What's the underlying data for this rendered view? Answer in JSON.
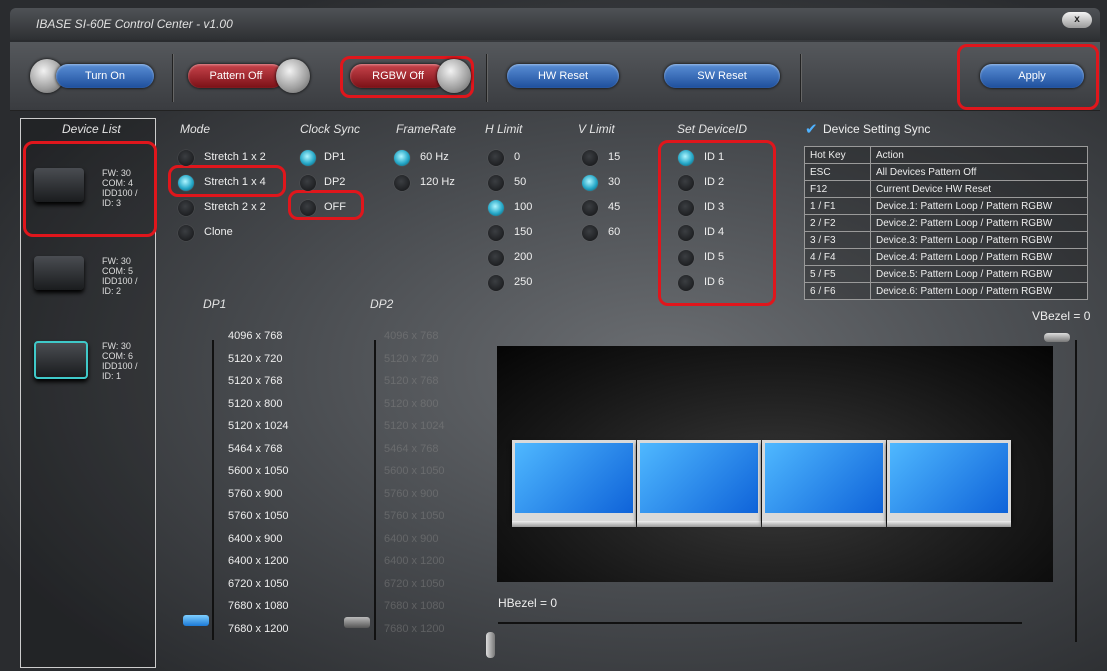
{
  "window": {
    "title": "IBASE SI-60E Control Center - v1.00",
    "close_label": "x"
  },
  "toolbar": {
    "turn_on": "Turn On",
    "pattern_off": "Pattern Off",
    "rgbw_off": "RGBW Off",
    "hw_reset": "HW Reset",
    "sw_reset": "SW Reset",
    "apply": "Apply"
  },
  "device_list": {
    "header": "Device List",
    "devices": [
      {
        "fw": "FW: 30",
        "com": "COM: 4",
        "idd": "IDD100 /",
        "id": "ID: 3"
      },
      {
        "fw": "FW: 30",
        "com": "COM: 5",
        "idd": "IDD100 /",
        "id": "ID: 2"
      },
      {
        "fw": "FW: 30",
        "com": "COM: 6",
        "idd": "IDD100 /",
        "id": "ID: 1"
      }
    ]
  },
  "headers": {
    "mode": "Mode",
    "clock_sync": "Clock Sync",
    "frame_rate": "FrameRate",
    "h_limit": "H Limit",
    "v_limit": "V Limit",
    "set_device_id": "Set DeviceID",
    "device_setting_sync": "Device Setting Sync"
  },
  "mode": [
    "Stretch 1 x 2",
    "Stretch 1 x 4",
    "Stretch 2 x 2",
    "Clone"
  ],
  "clock_sync": [
    "DP1",
    "DP2",
    "OFF"
  ],
  "frame_rate": [
    "60 Hz",
    "120 Hz"
  ],
  "h_limit": [
    "0",
    "50",
    "100",
    "150",
    "200",
    "250"
  ],
  "v_limit": [
    "15",
    "30",
    "45",
    "60"
  ],
  "device_ids": [
    "ID 1",
    "ID 2",
    "ID 3",
    "ID 4",
    "ID 5",
    "ID 6"
  ],
  "selected": {
    "mode": 1,
    "clock_sync": 0,
    "frame_rate": 0,
    "h_limit": 2,
    "v_limit": 1,
    "device_id": 0
  },
  "hotkeys": {
    "col_key": "Hot Key",
    "col_action": "Action",
    "rows": [
      {
        "key": "ESC",
        "action": "All Devices Pattern Off"
      },
      {
        "key": "F12",
        "action": "Current Device HW Reset"
      },
      {
        "key": "1 / F1",
        "action": "Device.1: Pattern Loop / Pattern RGBW"
      },
      {
        "key": "2 / F2",
        "action": "Device.2: Pattern Loop / Pattern RGBW"
      },
      {
        "key": "3 / F3",
        "action": "Device.3: Pattern Loop / Pattern RGBW"
      },
      {
        "key": "4 / F4",
        "action": "Device.4: Pattern Loop / Pattern RGBW"
      },
      {
        "key": "5 / F5",
        "action": "Device.5: Pattern Loop / Pattern RGBW"
      },
      {
        "key": "6 / F6",
        "action": "Device.6: Pattern Loop / Pattern RGBW"
      }
    ]
  },
  "dp1": {
    "label": "DP1",
    "resolutions": [
      "4096 x 768",
      "5120 x 720",
      "5120 x 768",
      "5120 x 800",
      "5120 x 1024",
      "5464 x 768",
      "5600 x 1050",
      "5760 x 900",
      "5760 x 1050",
      "6400 x 900",
      "6400 x 1200",
      "6720 x 1050",
      "7680 x 1080",
      "7680 x 1200"
    ]
  },
  "dp2": {
    "label": "DP2",
    "resolutions": [
      "4096 x 768",
      "5120 x 720",
      "5120 x 768",
      "5120 x 800",
      "5120 x 1024",
      "5464 x 768",
      "5600 x 1050",
      "5760 x 900",
      "5760 x 1050",
      "6400 x 900",
      "6400 x 1200",
      "6720 x 1050",
      "7680 x 1080",
      "7680 x 1200"
    ]
  },
  "bezel": {
    "v_label": "VBezel = 0",
    "h_label": "HBezel = 0"
  }
}
